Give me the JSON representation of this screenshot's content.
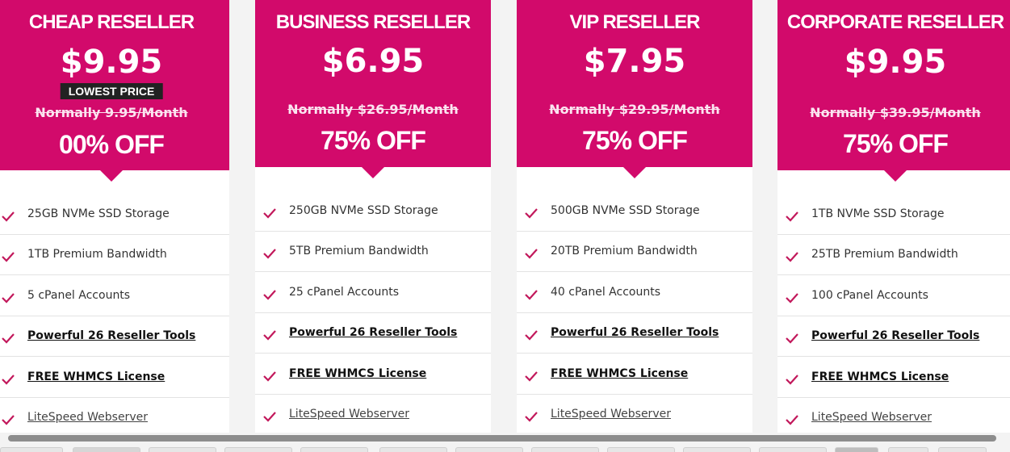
{
  "plans": [
    {
      "title": "CHEAP RESELLER",
      "price": "$9.95",
      "badge": "LOWEST PRICE",
      "normally": "Normally 9.95/Month",
      "discount": "00% OFF",
      "features": [
        {
          "text": "25GB NVMe SSD Storage",
          "style": "plain"
        },
        {
          "text": "1TB Premium Bandwidth",
          "style": "plain"
        },
        {
          "text": "5 cPanel Accounts",
          "style": "plain"
        },
        {
          "text": "Powerful 26 Reseller Tools",
          "style": "bold"
        },
        {
          "text": "FREE WHMCS License",
          "style": "bold"
        },
        {
          "text": "LiteSpeed Webserver",
          "style": "link"
        }
      ]
    },
    {
      "title": "BUSINESS RESELLER",
      "price": "$6.95",
      "badge": "",
      "normally": "Normally $26.95/Month",
      "discount": "75% OFF",
      "features": [
        {
          "text": "250GB NVMe SSD Storage",
          "style": "plain"
        },
        {
          "text": "5TB Premium Bandwidth",
          "style": "plain"
        },
        {
          "text": "25 cPanel Accounts",
          "style": "plain"
        },
        {
          "text": "Powerful 26 Reseller Tools",
          "style": "bold"
        },
        {
          "text": "FREE WHMCS License",
          "style": "bold"
        },
        {
          "text": "LiteSpeed Webserver",
          "style": "link"
        }
      ]
    },
    {
      "title": "VIP RESELLER",
      "price": "$7.95",
      "badge": "",
      "normally": "Normally $29.95/Month",
      "discount": "75% OFF",
      "features": [
        {
          "text": "500GB NVMe SSD Storage",
          "style": "plain"
        },
        {
          "text": "20TB Premium Bandwidth",
          "style": "plain"
        },
        {
          "text": "40 cPanel Accounts",
          "style": "plain"
        },
        {
          "text": "Powerful 26 Reseller Tools",
          "style": "bold"
        },
        {
          "text": "FREE WHMCS License",
          "style": "bold"
        },
        {
          "text": "LiteSpeed Webserver",
          "style": "link"
        }
      ]
    },
    {
      "title": "CORPORATE RESELLER",
      "price": "$9.95",
      "badge": "",
      "normally": "Normally $39.95/Month",
      "discount": "75% OFF",
      "features": [
        {
          "text": "1TB NVMe SSD Storage",
          "style": "plain"
        },
        {
          "text": "25TB Premium Bandwidth",
          "style": "plain"
        },
        {
          "text": "100 cPanel Accounts",
          "style": "plain"
        },
        {
          "text": "Powerful 26 Reseller Tools",
          "style": "bold"
        },
        {
          "text": "FREE WHMCS License",
          "style": "bold"
        },
        {
          "text": "LiteSpeed Webserver",
          "style": "link"
        }
      ]
    }
  ],
  "colors": {
    "accent": "#d20a6b",
    "check": "#c2185b",
    "badge_bg": "#222222"
  },
  "icons": {
    "feature_check": "check-icon"
  }
}
